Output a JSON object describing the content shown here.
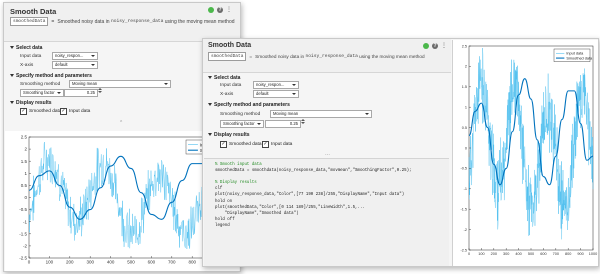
{
  "window_a": {
    "title": "Smooth Data",
    "output_var": "smoothedData",
    "eq": "=",
    "summary_pre": "Smoothed noisy data in",
    "summary_var": "noisy_response_data",
    "summary_post": "using the moving mean method",
    "section_select": "Select data",
    "label_input": "Input data",
    "input_value": "noisy_respon...",
    "label_xaxis": "X-axis",
    "xaxis_value": "default",
    "section_method": "Specify method and parameters",
    "label_method": "Smoothing method",
    "method_value": "Moving mean",
    "factor_label": "Smoothing factor",
    "factor_value": "0.25",
    "section_display": "Display results",
    "chk_smoothed": "Smoothed data",
    "chk_input": "Input data",
    "check_mark": "✓"
  },
  "window_b": {
    "title": "Smooth Data",
    "output_var": "smoothedData",
    "eq": "=",
    "summary_pre": "Smoothed noisy data in",
    "summary_var": "noisy_response_data",
    "summary_post": "using the moving mean method",
    "section_select": "Select data",
    "label_input": "Input data",
    "input_value": "noisy_respon...",
    "label_xaxis": "X-axis",
    "xaxis_value": "default",
    "section_method": "Specify method and parameters",
    "label_method": "Smoothing method",
    "method_value": "Moving mean",
    "factor_label": "Smoothing factor",
    "factor_value": "0.25",
    "section_display": "Display results",
    "chk_smoothed": "Smoothed data",
    "chk_input": "Input data",
    "check_mark": "✓",
    "code_lines": [
      {
        "cls": "c-com",
        "text": "% Smooth input data"
      },
      {
        "cls": "c-def",
        "text": "smoothedData = smoothdata(noisy_response_data,\"movmean\",\"SmoothingFactor\",0.25);"
      },
      {
        "cls": "c-def",
        "text": ""
      },
      {
        "cls": "c-com",
        "text": "% Display results"
      },
      {
        "cls": "c-def",
        "text": "clf"
      },
      {
        "cls": "c-def",
        "text": "plot(noisy_response_data,\"Color\",[77 190 238]/255,\"DisplayName\",\"Input data\")"
      },
      {
        "cls": "c-def",
        "text": "hold on"
      },
      {
        "cls": "c-def",
        "text": "plot(smoothedData,\"Color\",[0 114 189]/255,\"LineWidth\",1.5,..."
      },
      {
        "cls": "c-def",
        "text": "    \"DisplayName\",\"Smoothed data\")"
      },
      {
        "cls": "c-def",
        "text": "hold off"
      },
      {
        "cls": "c-def",
        "text": "legend"
      }
    ]
  },
  "icons": {
    "help": "?",
    "more": "⋮"
  },
  "chart_data": [
    {
      "type": "line",
      "title": "",
      "xlabel": "",
      "ylabel": "",
      "xlim": [
        0,
        1000
      ],
      "ylim": [
        -2.5,
        2.5
      ],
      "xticks": [
        0,
        100,
        200,
        300,
        400,
        500,
        600,
        700,
        800,
        900,
        1000
      ],
      "yticks": [
        -2.5,
        -2,
        -1.5,
        -1,
        -0.5,
        0,
        0.5,
        1,
        1.5,
        2,
        2.5
      ],
      "legend_position": "top-right",
      "grid": false,
      "series": [
        {
          "name": "Input data",
          "color": "#4dbeee",
          "description_values": "noisy sinusoid, amplitude ~1.5, period ~270 samples, noise std ~0.35"
        },
        {
          "name": "Smoothed data",
          "color": "#0072bd"
        }
      ],
      "smoothed_values_x": [
        0,
        50,
        100,
        150,
        200,
        250,
        300,
        350,
        400,
        450,
        500,
        550,
        600,
        650,
        700,
        750,
        800,
        850,
        900,
        950,
        1000
      ],
      "smoothed_values_y": [
        0.3,
        0.9,
        1.1,
        0.5,
        -0.4,
        -0.9,
        -0.5,
        0.4,
        1.3,
        1.7,
        1.2,
        0.2,
        -0.7,
        -0.9,
        -0.2,
        0.7,
        1.4,
        1.4,
        0.6,
        -0.3,
        -0.2
      ]
    },
    {
      "type": "line",
      "title": "",
      "xlabel": "",
      "ylabel": "",
      "xlim": [
        0,
        1000
      ],
      "ylim": [
        -2.5,
        2.5
      ],
      "xticks": [
        0,
        100,
        200,
        300,
        400,
        500,
        600,
        700,
        800,
        900,
        1000
      ],
      "yticks": [
        -2.5,
        -2,
        -1.5,
        -1,
        -0.5,
        0,
        0.5,
        1,
        1.5,
        2,
        2.5
      ],
      "legend_position": "top-right",
      "grid": false,
      "series": [
        {
          "name": "Input data",
          "color": "#4dbeee"
        },
        {
          "name": "Smoothed data",
          "color": "#0072bd"
        }
      ]
    }
  ]
}
